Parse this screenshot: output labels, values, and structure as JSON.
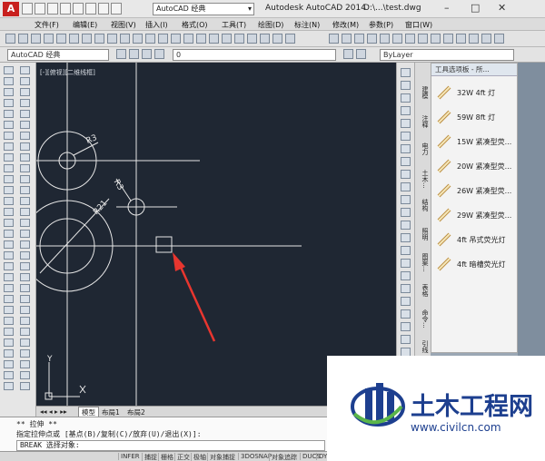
{
  "titlebar": {
    "logo_letter": "A",
    "workspace": "AutoCAD 经典",
    "app_name": "Autodesk AutoCAD 2014",
    "file_name": "D:\\...\\test.dwg",
    "min": "–",
    "max": "□",
    "close": "✕"
  },
  "menu": [
    "文件(F)",
    "编辑(E)",
    "视图(V)",
    "插入(I)",
    "格式(O)",
    "工具(T)",
    "绘图(D)",
    "标注(N)",
    "修改(M)",
    "参数(P)",
    "窗口(W)"
  ],
  "toolbar2": {
    "workspace": "AutoCAD 经典",
    "layer": "0",
    "color": "ByLayer"
  },
  "canvas": {
    "view_label": "[-][俯视][二维线框]",
    "dim_r3_top": "R3",
    "dim_r3_mid": "R3",
    "dim_r21": "R21",
    "ucs_y": "Y",
    "ucs_x": "X"
  },
  "palette": {
    "title": "工具选项板 - 所...",
    "items": [
      "32W 4ft 灯",
      "59W 8ft 灯",
      "15W 紧凑型荧...",
      "20W 紧凑型荧...",
      "26W 紧凑型荧...",
      "29W 紧凑型荧...",
      "4ft 吊式荧光灯",
      "4ft 暗槽荧光灯"
    ],
    "tabs": [
      "建模",
      "注释",
      "电力",
      "土木...",
      "结构",
      "照明",
      "图案...",
      "表格",
      "命令...",
      "引线",
      "视图",
      "光源"
    ]
  },
  "layout_tabs": [
    "模型",
    "布局1",
    "布局2"
  ],
  "command": {
    "line1": "** 拉伸 **",
    "line2": "指定拉伸点或 [基点(B)/复制(C)/放弃(U)/退出(X)]:",
    "input": "BREAK 选择对象:"
  },
  "status": [
    "INFER",
    "捕捉",
    "栅格",
    "正交",
    "极轴",
    "对象捕捉",
    "3DOSNAP",
    "对象追踪",
    "DUCS",
    "DYN"
  ],
  "watermark": {
    "title": "土木工程网",
    "url": "www.civilcn.com"
  },
  "colors": {
    "canvas": "#1f2733",
    "cad_lines": "#e6e6e6",
    "arrow": "#e8362f",
    "brand": "#1d3f8f"
  }
}
